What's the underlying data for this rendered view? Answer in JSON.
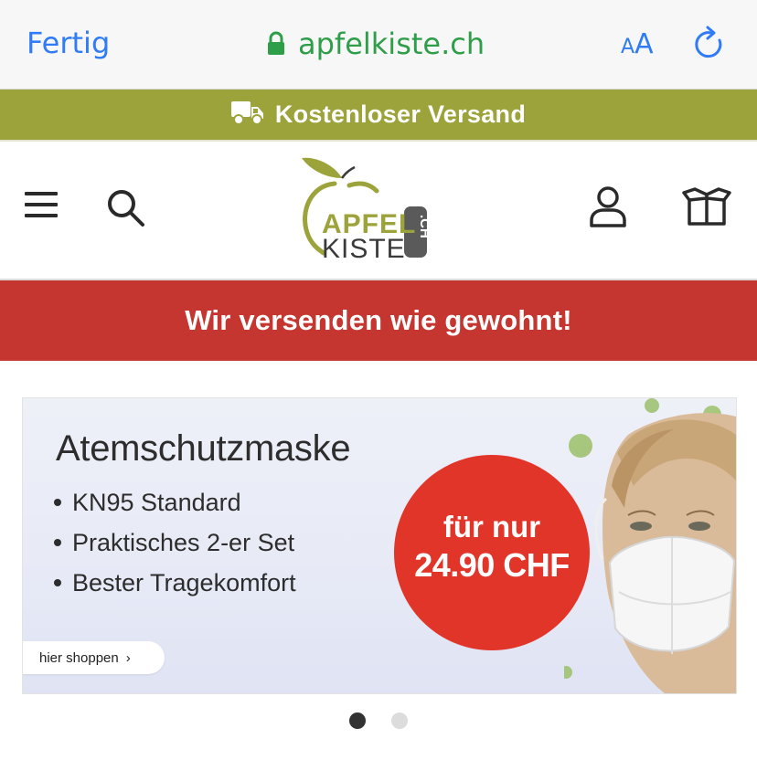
{
  "browser": {
    "done_label": "Fertig",
    "url": "apfelkiste.ch",
    "text_size_small": "A",
    "text_size_big": "A",
    "lock_icon": "lock-icon",
    "reload_icon": "reload-icon"
  },
  "shipping": {
    "text": "Kostenloser Versand",
    "icon": "truck-icon",
    "bg": "#9ca33a"
  },
  "header": {
    "menu_icon": "hamburger-menu-icon",
    "search_icon": "search-icon",
    "logo": {
      "line1": "APFEL",
      "line2": "KISTE",
      "suffix": ".CH"
    },
    "user_icon": "user-icon",
    "cart_icon": "box-icon"
  },
  "notice": {
    "text": "Wir versenden wie gewohnt!",
    "bg": "#c63630"
  },
  "hero": {
    "title": "Atemschutzmaske",
    "bullets": [
      "KN95 Standard",
      "Praktisches 2-er Set",
      "Bester Tragekomfort"
    ],
    "price_line1": "für nur",
    "price_line2": "24.90 CHF",
    "cta_label": "hier shoppen",
    "cta_chevron": "›",
    "price_color": "#e2352a"
  },
  "carousel": {
    "slide_count": 2,
    "active_index": 0
  }
}
